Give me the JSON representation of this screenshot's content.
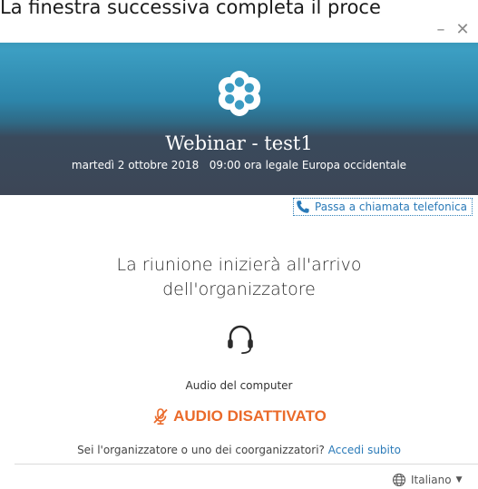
{
  "document_caption": "La finestra successiva completa il proce",
  "window": {
    "minimize_glyph": "–",
    "close_glyph": "✕"
  },
  "meeting": {
    "title": "Webinar - test1",
    "datetime": "martedì 2 ottobre 2018   09:00 ora legale Europa occidentale"
  },
  "phone_switch_label": "Passa a chiamata telefonica",
  "waiting_message_line1": "La riunione inizierà all'arrivo",
  "waiting_message_line2": "dell'organizzatore",
  "audio": {
    "label": "Audio del computer",
    "status": "AUDIO DISATTIVATO"
  },
  "organizer_prompt": "Sei l'organizzatore o uno dei coorganizzatori?",
  "organizer_link": "Accedi subito",
  "language": "Italiano",
  "colors": {
    "banner_top": "#3ea2c6",
    "banner_bottom": "#3c4656",
    "link": "#2a7ab8",
    "muted_orange": "#ea6a2a"
  },
  "icons": {
    "logo": "gotomeeting-flower-logo",
    "phone": "phone-icon",
    "headset": "headset-icon",
    "mic_off": "mic-off-icon",
    "globe": "globe-icon",
    "dropdown": "chevron-down-icon"
  }
}
